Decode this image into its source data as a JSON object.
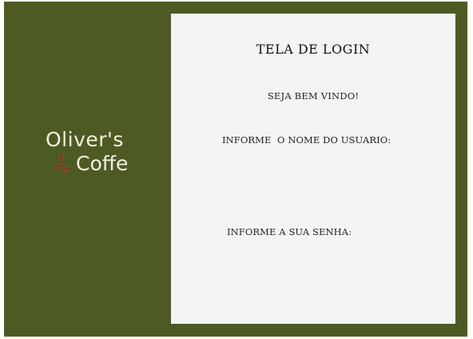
{
  "brand": {
    "line1": "Oliver's",
    "line2": "Coffe",
    "icon": "coffee-beans-icon"
  },
  "login": {
    "title": "TELA DE LOGIN",
    "welcome": "SEJA BEM VINDO!",
    "username_label": "INFORME  O NOME DO USUARIO:",
    "username_value": "",
    "password_label": "INFORME A SUA SENHA:",
    "password_value": ""
  },
  "colors": {
    "sidebar_bg": "#4e5a24",
    "panel_bg": "#f4f4f4",
    "brand_text": "#f3f0dd",
    "bean": "#8a4a2a"
  }
}
